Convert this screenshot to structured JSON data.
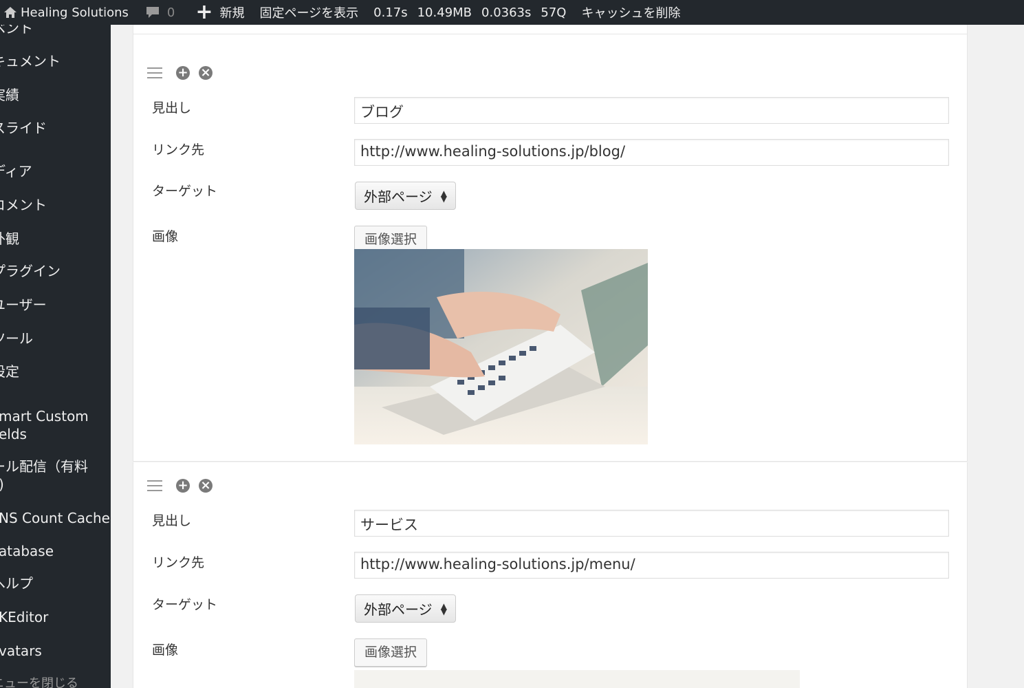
{
  "adminbar": {
    "site_name": "Healing Solutions",
    "comments_count": "0",
    "new_label": "新規",
    "view_page": "固定ページを表示",
    "stats": [
      "0.17s",
      "10.49MB",
      "0.0363s",
      "57Q"
    ],
    "clear_cache": "キャッシュを削除"
  },
  "sidebar": {
    "items": [
      "ベント",
      "キュメント",
      "実績",
      "スライド",
      "ディア",
      "コメント",
      "外観",
      "プラグイン",
      "ユーザー",
      "ツール",
      "設定",
      "mart Custom",
      "elds",
      "ール配信（有料",
      "ｼ)",
      "NS Count Cache",
      "atabase",
      "ヘルプ",
      "KEditor",
      "vatars",
      "ニューを閉じる"
    ]
  },
  "groups": [
    {
      "heading_label": "見出し",
      "heading_value": "ブログ",
      "link_label": "リンク先",
      "link_value": "http://www.healing-solutions.jp/blog/",
      "target_label": "ターゲット",
      "target_value": "外部ページ",
      "image_label": "画像",
      "image_button": "画像選択"
    },
    {
      "heading_label": "見出し",
      "heading_value": "サービス",
      "link_label": "リンク先",
      "link_value": "http://www.healing-solutions.jp/menu/",
      "target_label": "ターゲット",
      "target_value": "外部ページ",
      "image_label": "画像",
      "image_button": "画像選択"
    }
  ],
  "colors": {
    "adminbar_bg": "#23282d",
    "panel_bg": "#ffffff",
    "page_bg": "#f1f1f1"
  }
}
